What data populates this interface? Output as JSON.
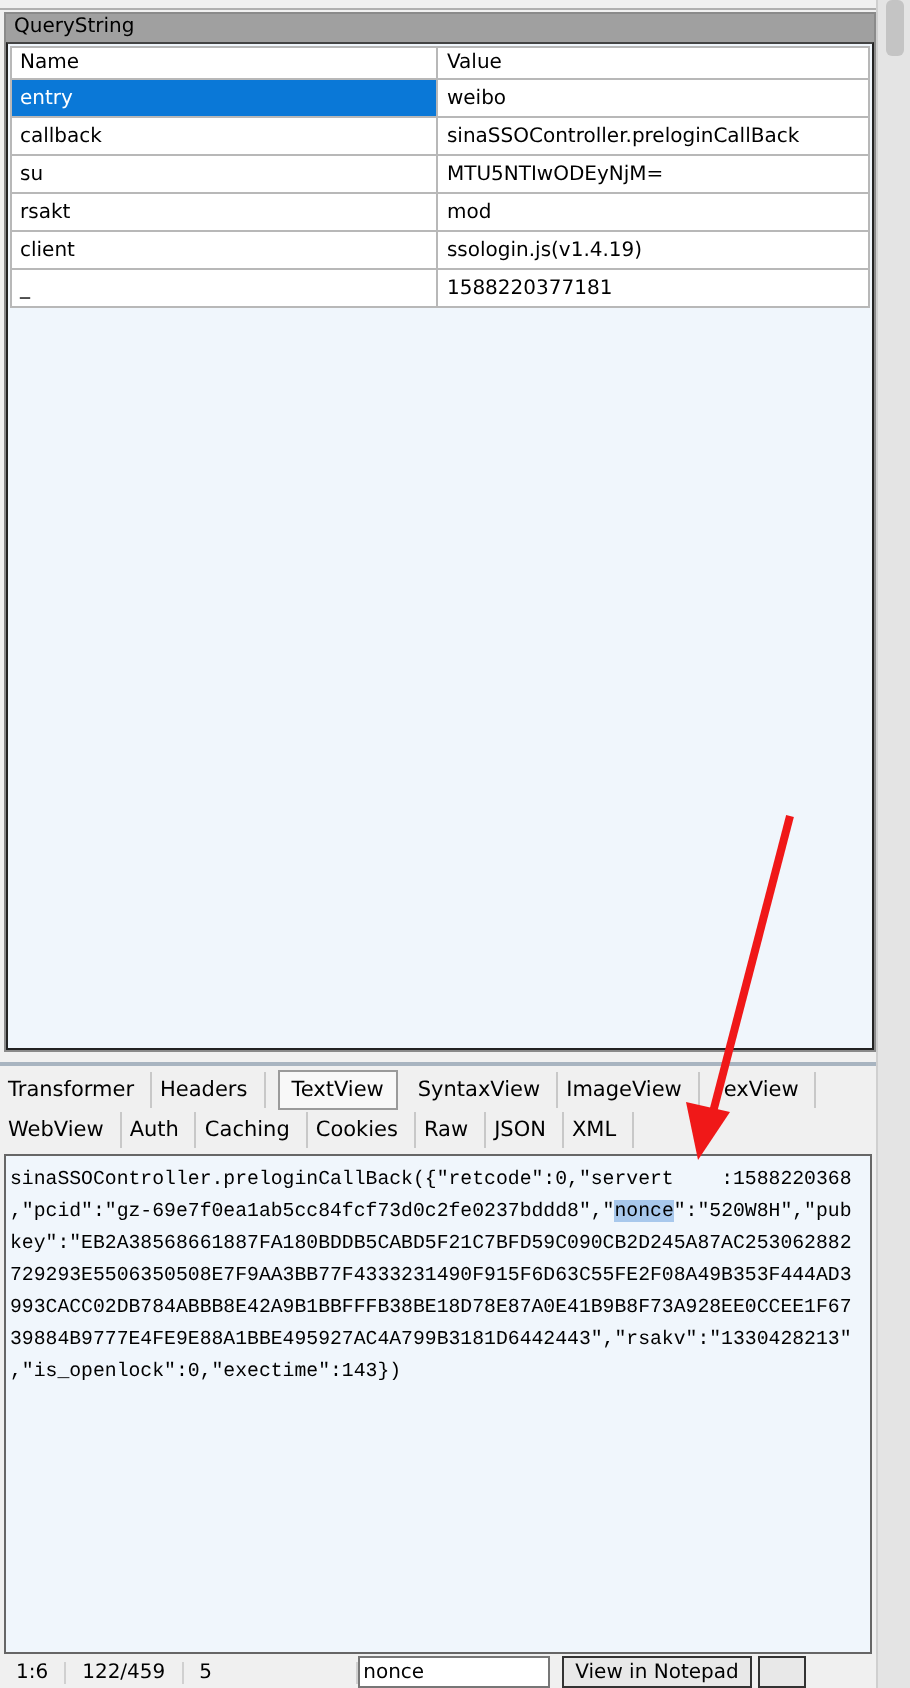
{
  "query_string": {
    "title": "QueryString",
    "columns": [
      "Name",
      "Value"
    ],
    "rows": [
      {
        "name": "entry",
        "value": "weibo",
        "selected": true
      },
      {
        "name": "callback",
        "value": "sinaSSOController.preloginCallBack",
        "selected": false
      },
      {
        "name": "su",
        "value": "MTU5NTIwODEyNjM=",
        "selected": false
      },
      {
        "name": "rsakt",
        "value": "mod",
        "selected": false
      },
      {
        "name": "client",
        "value": "ssologin.js(v1.4.19)",
        "selected": false
      },
      {
        "name": "_",
        "value": "1588220377181",
        "selected": false
      }
    ]
  },
  "response_tabs": [
    [
      {
        "label": "Transformer",
        "selected": false
      },
      {
        "label": "Headers",
        "selected": false
      },
      {
        "label": "TextView",
        "selected": true
      },
      {
        "label": "SyntaxView",
        "selected": false
      },
      {
        "label": "ImageView",
        "selected": false
      },
      {
        "label": "exView",
        "selected": false,
        "cut_at_start": true
      }
    ],
    [
      {
        "label": "WebView",
        "selected": false
      },
      {
        "label": "Auth",
        "selected": false
      },
      {
        "label": "Caching",
        "selected": false
      },
      {
        "label": "Cookies",
        "selected": false
      },
      {
        "label": "Raw",
        "selected": false
      },
      {
        "label": "JSON",
        "selected": false
      },
      {
        "label": "XML",
        "selected": false
      }
    ]
  ],
  "text_view": {
    "lines": [
      [
        {
          "text": "sinaSSOController.preloginCallBack({\"retcode\":0,\"servert",
          "highlighted": false
        },
        {
          "text": ":1588220368",
          "highlighted": false,
          "cut_at_start": true
        }
      ],
      [
        {
          "text": ",\"pcid\":\"gz-69e7f0ea1ab5cc84fcf73d0c2fe0237bddd8\",\"",
          "highlighted": false
        },
        {
          "text": "nonce",
          "highlighted": true
        },
        {
          "text": "\":\"520W8H\",\"pub",
          "highlighted": false
        }
      ],
      [
        {
          "text": "key\":\"EB2A38568661887FA180BDDB5CABD5F21C7BFD59C090CB2D245A87AC253062882",
          "highlighted": false
        }
      ],
      [
        {
          "text": "729293E5506350508E7F9AA3BB77F4333231490F915F6D63C55FE2F08A49B353F444AD3",
          "highlighted": false
        }
      ],
      [
        {
          "text": "993CACC02DB784ABBB8E42A9B1BBFFFB38BE18D78E87A0E41B9B8F73A928EE0CCEE1F67",
          "highlighted": false
        }
      ],
      [
        {
          "text": "39884B9777E4FE9E88A1BBE495927AC4A799B3181D6442443\",\"rsakv\":\"1330428213\"",
          "highlighted": false
        }
      ],
      [
        {
          "text": ",\"is_openlock\":0,\"exectime\":143})",
          "highlighted": false
        }
      ]
    ]
  },
  "status_bar": {
    "position": "1:6",
    "offset": "122/459",
    "count": "5",
    "find": {
      "value": "nonce"
    },
    "button": "View in Notepad"
  }
}
